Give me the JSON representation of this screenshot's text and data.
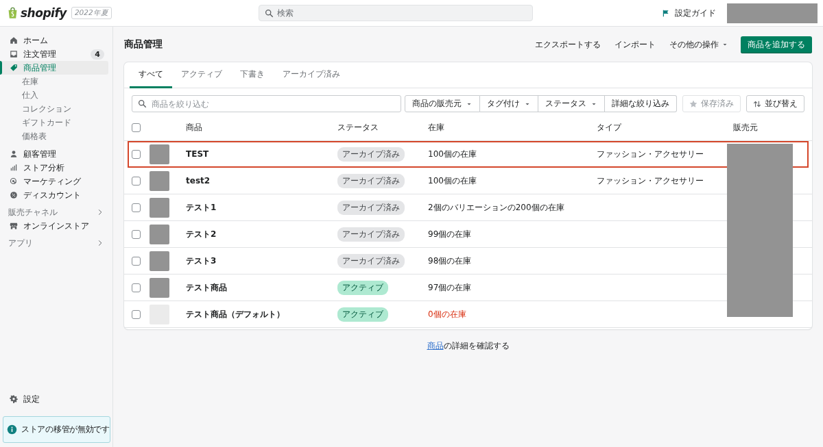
{
  "topbar": {
    "logo": "shopify",
    "edition": "2022年夏",
    "search": {
      "placeholder": "検索"
    },
    "setup_guide": "設定ガイド"
  },
  "sidebar": {
    "items": [
      {
        "label": "ホーム",
        "selected": false
      },
      {
        "label": "注文管理",
        "badge": "4",
        "selected": false
      },
      {
        "label": "商品管理",
        "selected": true,
        "children": [
          {
            "label": "在庫",
            "selected": false
          },
          {
            "label": "仕入",
            "selected": false
          },
          {
            "label": "コレクション",
            "selected": false
          },
          {
            "label": "ギフトカード",
            "selected": false
          },
          {
            "label": "価格表",
            "selected": false
          }
        ]
      },
      {
        "label": "顧客管理",
        "selected": false
      },
      {
        "label": "ストア分析",
        "selected": false
      },
      {
        "label": "マーケティング",
        "selected": false
      },
      {
        "label": "ディスカウント",
        "selected": false
      }
    ],
    "sections": [
      {
        "title": "販売チャネル",
        "items": [
          {
            "label": "オンラインストア",
            "selected": false
          }
        ]
      },
      {
        "title": "アプリ"
      }
    ],
    "settings": "設定",
    "notice": "ストアの移管が無効です"
  },
  "page": {
    "title": "商品管理",
    "actions": [
      {
        "label": "エクスポートする",
        "kind": "plain"
      },
      {
        "label": "インポート",
        "kind": "plain"
      },
      {
        "label": "その他の操作",
        "kind": "menu"
      },
      {
        "label": "商品を追加する",
        "kind": "primary"
      }
    ],
    "tabs": [
      {
        "label": "すべて",
        "selected": true
      },
      {
        "label": "アクティブ",
        "selected": false
      },
      {
        "label": "下書き",
        "selected": false
      },
      {
        "label": "アーカイブ済み",
        "selected": false
      }
    ],
    "filter": {
      "placeholder": "商品を絞り込む",
      "buttons": [
        {
          "label": "商品の販売元",
          "dropdown": true
        },
        {
          "label": "タグ付け",
          "dropdown": true
        },
        {
          "label": "ステータス",
          "dropdown": true
        },
        {
          "label": "詳細な絞り込み",
          "dropdown": false
        }
      ],
      "saved": {
        "label": "保存済み",
        "disabled": true
      },
      "sort": "並び替え"
    },
    "table": {
      "select_all": {
        "checked": false
      },
      "columns": [
        "商品",
        "ステータス",
        "在庫",
        "タイプ",
        "販売元"
      ],
      "rows": [
        {
          "checked": false,
          "highlighted": true,
          "has_image": true,
          "name": "TEST",
          "status": {
            "label": "アーカイブ済み",
            "kind": "archived"
          },
          "stock": "100個の在庫",
          "stock_warning": false,
          "type": "ファッション・アクセサリー"
        },
        {
          "checked": false,
          "highlighted": false,
          "has_image": true,
          "name": "test2",
          "status": {
            "label": "アーカイブ済み",
            "kind": "archived"
          },
          "stock": "100個の在庫",
          "stock_warning": false,
          "type": "ファッション・アクセサリー"
        },
        {
          "checked": false,
          "highlighted": false,
          "has_image": true,
          "name": "テスト1",
          "status": {
            "label": "アーカイブ済み",
            "kind": "archived"
          },
          "stock": "2個のバリエーションの200個の在庫",
          "stock_warning": false
        },
        {
          "checked": false,
          "highlighted": false,
          "has_image": true,
          "name": "テスト2",
          "status": {
            "label": "アーカイブ済み",
            "kind": "archived"
          },
          "stock": "99個の在庫",
          "stock_warning": false
        },
        {
          "checked": false,
          "highlighted": false,
          "has_image": true,
          "name": "テスト3",
          "status": {
            "label": "アーカイブ済み",
            "kind": "archived"
          },
          "stock": "98個の在庫",
          "stock_warning": false
        },
        {
          "checked": false,
          "highlighted": false,
          "has_image": true,
          "name": "テスト商品",
          "status": {
            "label": "アクティブ",
            "kind": "active"
          },
          "stock": "97個の在庫",
          "stock_warning": false
        },
        {
          "checked": false,
          "highlighted": false,
          "has_image": false,
          "name": "テスト商品（デフォルト）",
          "status": {
            "label": "アクティブ",
            "kind": "active"
          },
          "stock": "0個の在庫",
          "stock_warning": true
        }
      ]
    },
    "footer": {
      "link": "商品",
      "text": "の詳細を確認する"
    }
  }
}
